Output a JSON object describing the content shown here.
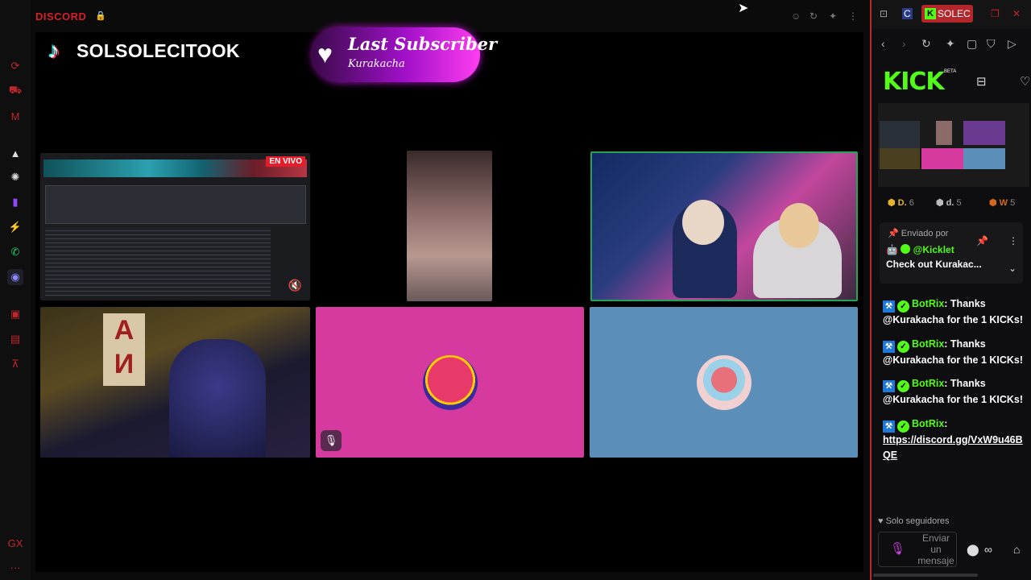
{
  "app": {
    "title": "DISCORD",
    "lock_icon": "lock-icon",
    "top_controls": [
      "emoji-icon",
      "reload-icon",
      "pin-icon",
      "more-icon"
    ]
  },
  "sidebar": {
    "icons": [
      {
        "name": "refresh-icon",
        "glyph": "⟳",
        "tone": "red"
      },
      {
        "name": "briefcase-icon",
        "glyph": "⛟",
        "tone": "red"
      },
      {
        "name": "gmail-icon",
        "glyph": "M",
        "tone": "red"
      },
      {
        "name": "aria-icon",
        "glyph": "▲",
        "tone": "white"
      },
      {
        "name": "chatgpt-icon",
        "glyph": "✺",
        "tone": "white"
      },
      {
        "name": "twitch-icon",
        "glyph": "▮",
        "tone": "purple"
      },
      {
        "name": "messenger-icon",
        "glyph": "⚡",
        "tone": "blue"
      },
      {
        "name": "whatsapp-icon",
        "glyph": "✆",
        "tone": "green"
      },
      {
        "name": "discord-icon",
        "glyph": "◉",
        "tone": "active"
      },
      {
        "name": "square-icon",
        "glyph": "▣",
        "tone": "red"
      },
      {
        "name": "box-icon",
        "glyph": "▤",
        "tone": "red"
      },
      {
        "name": "pin-icon",
        "glyph": "⊼",
        "tone": "red"
      },
      {
        "name": "gx-icon",
        "glyph": "GX",
        "tone": "red"
      },
      {
        "name": "more-icon",
        "glyph": "···",
        "tone": "red"
      }
    ]
  },
  "stream": {
    "channel_name": "SOLSOLECITOOK",
    "last_subscriber_label": "Last Subscriber",
    "last_subscriber_name": "Kurakacha",
    "live_tag": "EN VIVO",
    "sign_text": "A\nИ"
  },
  "panel": {
    "tab_label": "SOLEC",
    "kick_logo": "KICK",
    "beta": "BETA",
    "badges": [
      {
        "label": "D.",
        "value": "6",
        "color": "#e8b42a"
      },
      {
        "label": "d.",
        "value": "5",
        "color": "#bbbbbb"
      },
      {
        "label": "W",
        "value": "5",
        "color": "#d2691e"
      }
    ],
    "pinned": {
      "header": "Enviado por",
      "user": "@Kicklet",
      "message": "Check out Kurakac..."
    },
    "messages": [
      {
        "user": "BotRix",
        "text": "Thanks @Kurakacha for the 1 KICKs!"
      },
      {
        "user": "BotRix",
        "text": "Thanks @Kurakacha for the 1 KICKs!"
      },
      {
        "user": "BotRix",
        "text": "Thanks @Kurakacha for the 1 KICKs!"
      },
      {
        "user": "BotRix",
        "text": "",
        "link": "https://discord.gg/VxW9u46BQE"
      }
    ],
    "followers_only": "Solo seguidores",
    "input_placeholder": "Enviar un mensaje"
  }
}
